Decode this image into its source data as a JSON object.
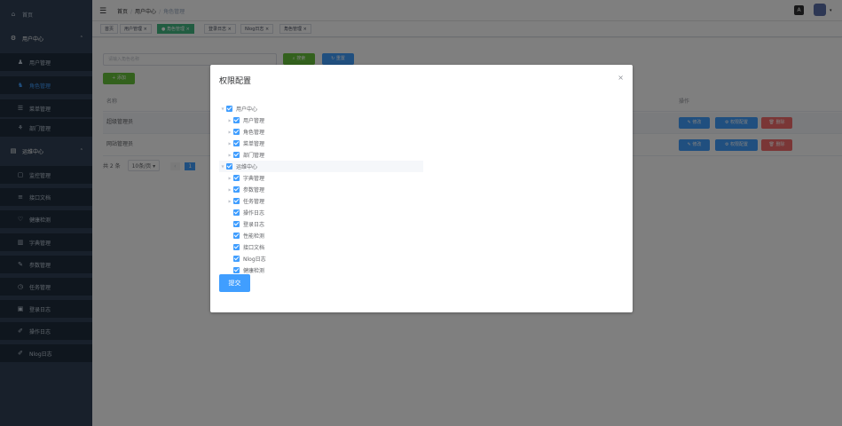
{
  "sidebar": {
    "home": "首页",
    "user_center": "用户中心",
    "user_items": [
      "用户管理",
      "角色管理",
      "菜单管理",
      "部门管理"
    ],
    "ops_center": "运维中心",
    "ops_items": [
      "监控管理",
      "接口文档",
      "健康检测",
      "字典管理",
      "参数管理",
      "任务管理",
      "登录日志",
      "操作日志",
      "Nlog日志"
    ],
    "active_item": "角色管理"
  },
  "header": {
    "breadcrumb": [
      "首页",
      "用户中心",
      "角色管理"
    ],
    "icon_label": "A"
  },
  "tags": [
    {
      "label": "首页",
      "active": false
    },
    {
      "label": "用户管理",
      "active": false
    },
    {
      "label": "角色管理",
      "active": true
    },
    {
      "label": "登录日志",
      "active": false
    },
    {
      "label": "Nlog日志",
      "active": false
    },
    {
      "label": "角色管理",
      "active": false
    }
  ],
  "toolbar": {
    "search_placeholder": "请输入角色名称",
    "search_button": "搜索",
    "reset_button": "重置",
    "add_button": "+ 添加"
  },
  "table": {
    "headers": [
      "名称",
      "操作"
    ],
    "rows": [
      {
        "name": "超级管理员"
      },
      {
        "name": "网站管理员"
      }
    ],
    "actions": [
      "修改",
      "权限配置",
      "删除"
    ]
  },
  "pager": {
    "total": "共 2 条",
    "page_size": "10条/页",
    "current_page": "1"
  },
  "dialog": {
    "title": "权限配置",
    "tree": [
      {
        "label": "用户中心",
        "level": 0,
        "expanded": true
      },
      {
        "label": "用户管理",
        "level": 1,
        "expandable": true
      },
      {
        "label": "角色管理",
        "level": 1,
        "expandable": true
      },
      {
        "label": "菜单管理",
        "level": 1,
        "expandable": true
      },
      {
        "label": "部门管理",
        "level": 1,
        "expandable": true
      },
      {
        "label": "运维中心",
        "level": 0,
        "expanded": true
      },
      {
        "label": "字典管理",
        "level": 1,
        "expandable": true
      },
      {
        "label": "参数管理",
        "level": 1,
        "expandable": true
      },
      {
        "label": "任务管理",
        "level": 1,
        "expandable": true
      },
      {
        "label": "操作日志",
        "level": 1,
        "expandable": false
      },
      {
        "label": "登录日志",
        "level": 1,
        "expandable": false
      },
      {
        "label": "性能检测",
        "level": 1,
        "expandable": false
      },
      {
        "label": "接口文档",
        "level": 1,
        "expandable": false
      },
      {
        "label": "Nlog日志",
        "level": 1,
        "expandable": false
      },
      {
        "label": "健康检测",
        "level": 1,
        "expandable": false
      }
    ],
    "submit": "提交"
  },
  "colors": {
    "sidebar_bg": "#304156",
    "primary": "#409eff",
    "success": "#67c23a",
    "danger": "#f56c6c",
    "tag_active": "#42b983"
  }
}
